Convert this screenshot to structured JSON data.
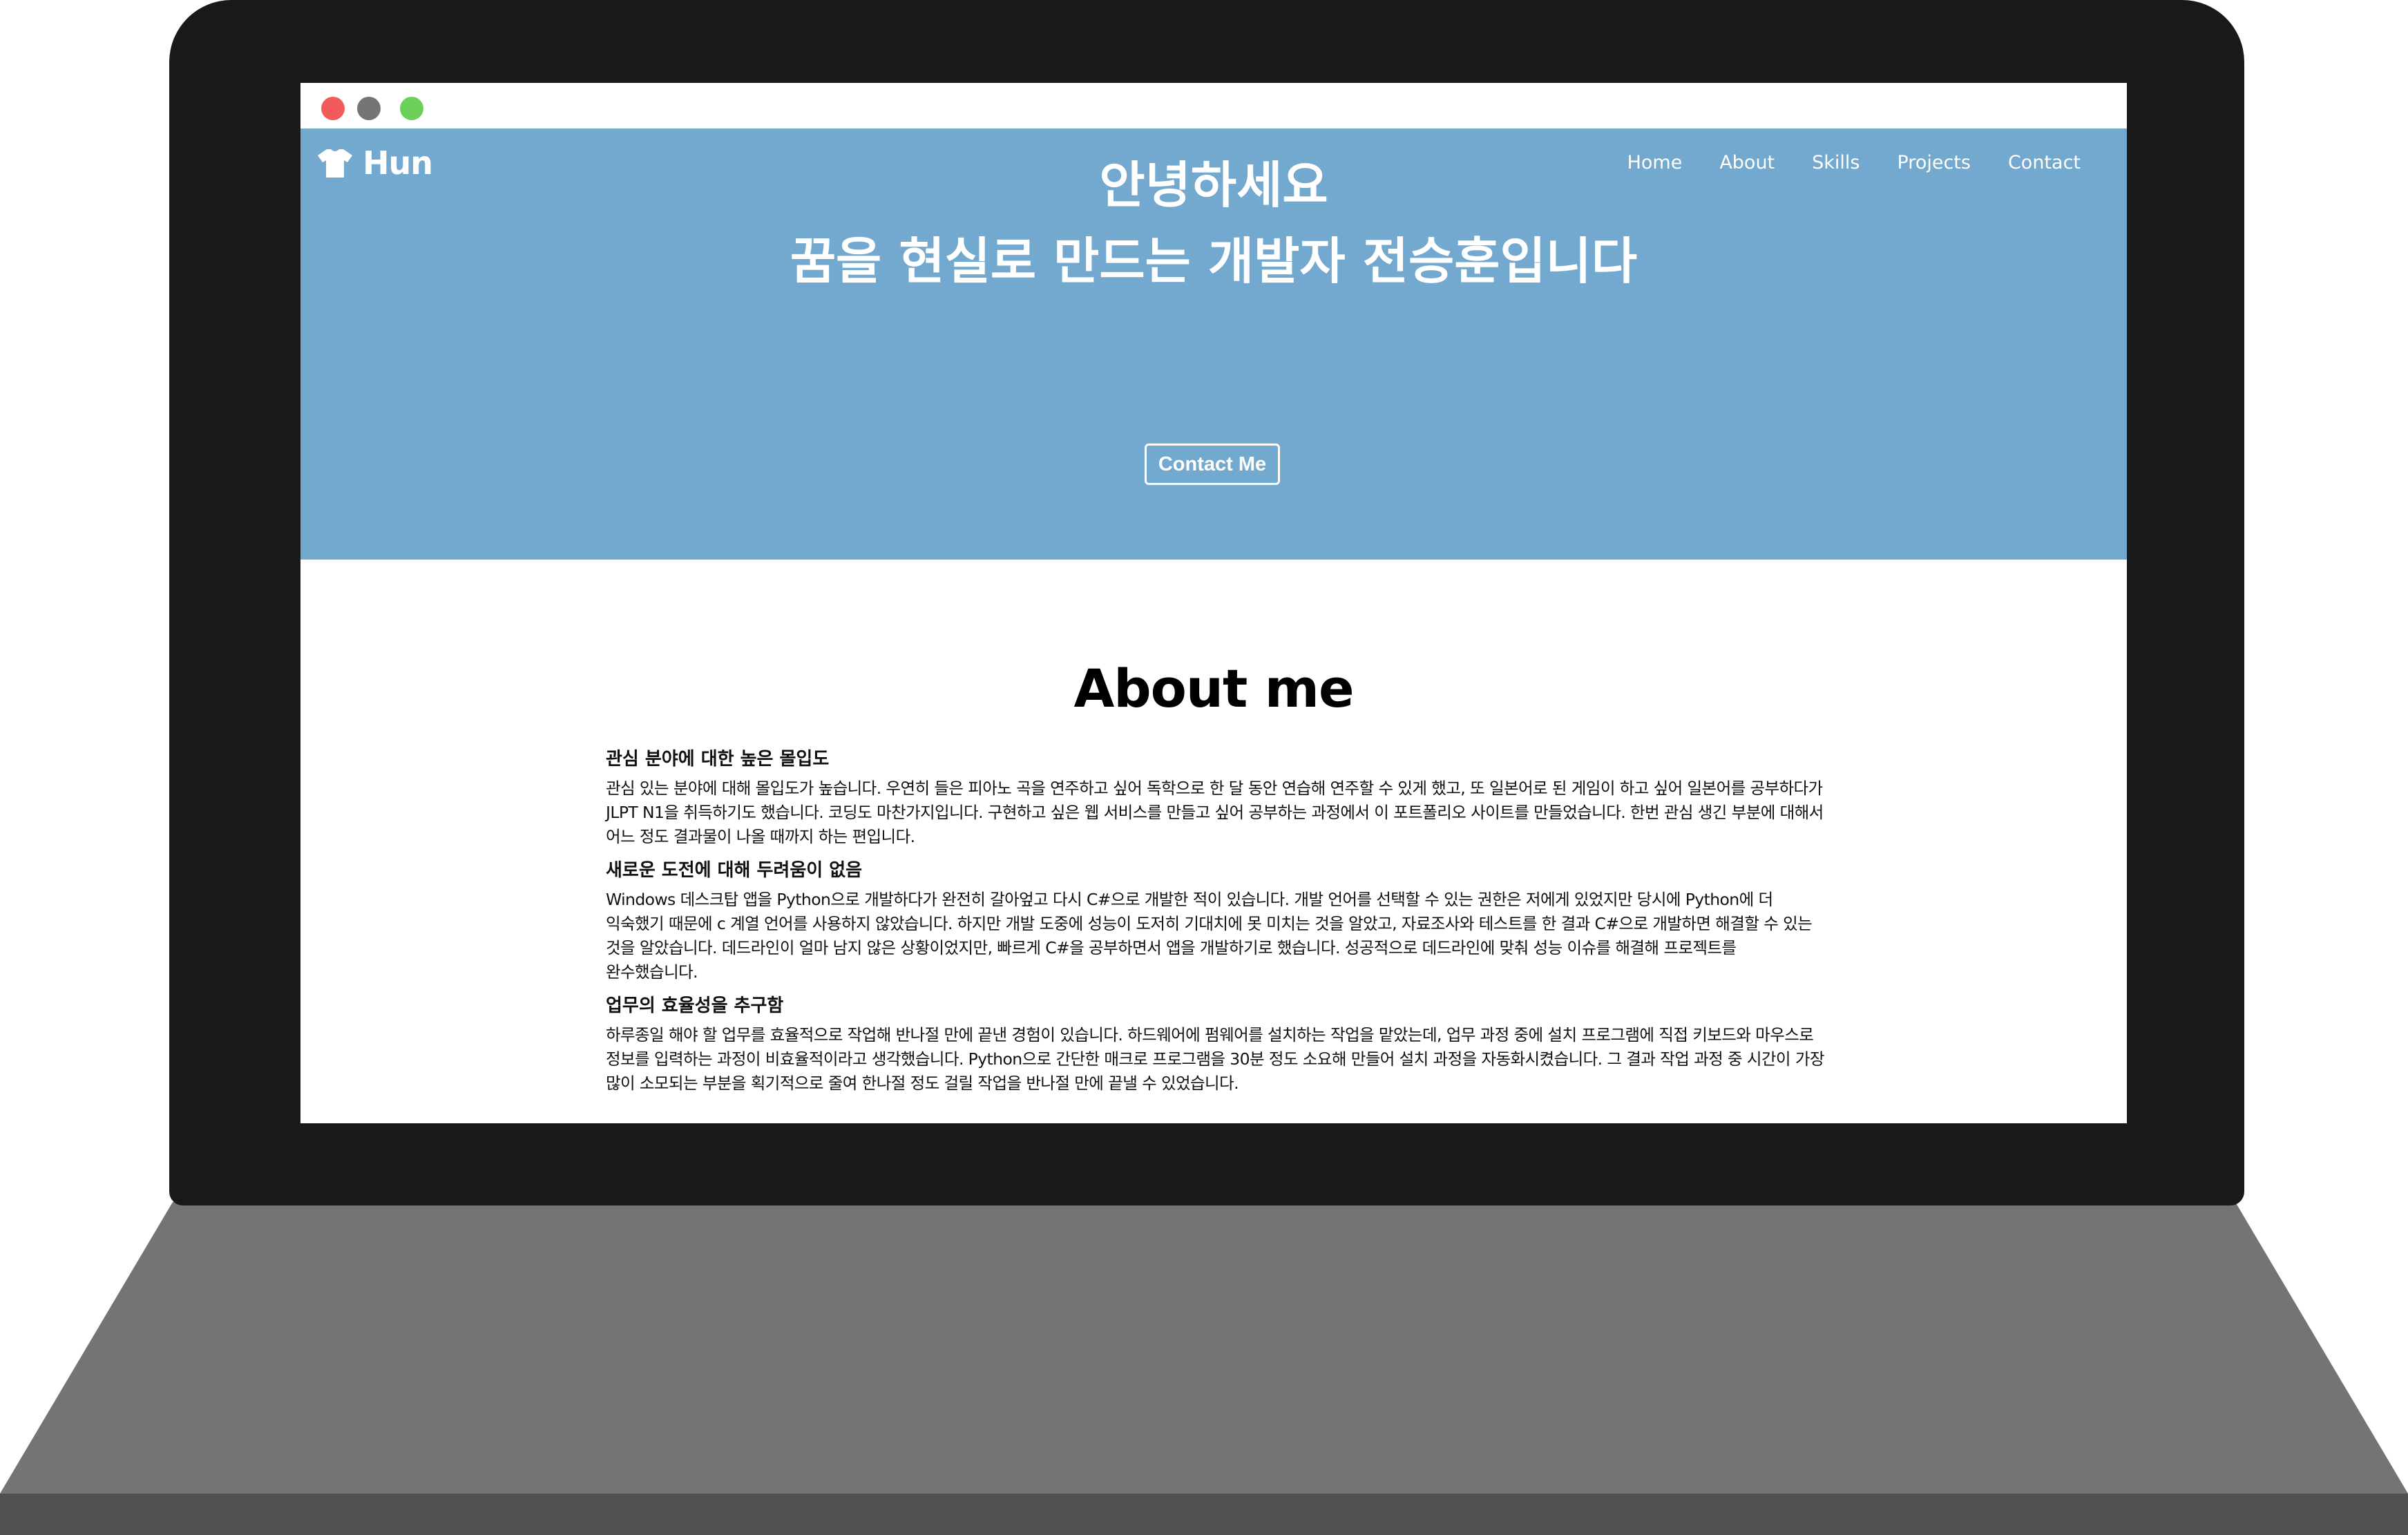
{
  "colors": {
    "hero_bg": "#73a9cf",
    "laptop_bezel": "#191919",
    "laptop_base": "#747474",
    "laptop_base_edge": "#505050",
    "traffic_red": "#f15b5b",
    "traffic_gray": "#757575",
    "traffic_green": "#6ccf58"
  },
  "window": {
    "controls": [
      "close",
      "minimize",
      "maximize"
    ]
  },
  "navbar": {
    "brand_icon": "shirt-icon",
    "brand": "Hun",
    "menu": [
      {
        "label": "Home"
      },
      {
        "label": "About"
      },
      {
        "label": "Skills"
      },
      {
        "label": "Projects"
      },
      {
        "label": "Contact"
      }
    ]
  },
  "hero": {
    "line1": "안녕하세요",
    "line2": "꿈을 현실로 만드는 개발자 전승훈입니다",
    "button": "Contact Me"
  },
  "about": {
    "title": "About me",
    "sections": [
      {
        "heading": "관심 분야에 대한 높은 몰입도",
        "text": "관심 있는 분야에 대해 몰입도가 높습니다. 우연히 들은 피아노 곡을 연주하고 싶어 독학으로 한 달 동안 연습해 연주할 수 있게 했고, 또 일본어로 된 게임이 하고 싶어 일본어를 공부하다가 JLPT N1을 취득하기도 했습니다. 코딩도 마찬가지입니다. 구현하고 싶은 웹 서비스를 만들고 싶어 공부하는 과정에서 이 포트폴리오 사이트를 만들었습니다. 한번 관심 생긴 부분에 대해서 어느 정도 결과물이 나올 때까지 하는 편입니다."
      },
      {
        "heading": "새로운 도전에 대해 두려움이 없음",
        "text": "Windows 데스크탑 앱을 Python으로 개발하다가 완전히 갈아엎고 다시 C#으로 개발한 적이 있습니다. 개발 언어를 선택할 수 있는 권한은 저에게 있었지만 당시에 Python에 더 익숙했기 때문에 c 계열 언어를 사용하지 않았습니다. 하지만 개발 도중에 성능이 도저히 기대치에 못 미치는 것을 알았고, 자료조사와 테스트를 한 결과 C#으로 개발하면 해결할 수 있는 것을 알았습니다. 데드라인이 얼마 남지 않은 상황이었지만, 빠르게 C#을 공부하면서 앱을 개발하기로 했습니다. 성공적으로 데드라인에 맞춰 성능 이슈를 해결해 프로젝트를 완수했습니다."
      },
      {
        "heading": "업무의 효율성을 추구함",
        "text": "하루종일 해야 할 업무를 효율적으로 작업해 반나절 만에 끝낸 경험이 있습니다. 하드웨어에 펌웨어를 설치하는 작업을 맡았는데, 업무 과정 중에 설치 프로그램에 직접 키보드와 마우스로 정보를 입력하는 과정이 비효율적이라고 생각했습니다. Python으로 간단한 매크로 프로그램을 30분 정도 소요해 만들어 설치 과정을 자동화시켰습니다. 그 결과 작업 과정 중 시간이 가장 많이 소모되는 부분을 획기적으로 줄여 한나절 정도 걸릴 작업을 반나절 만에 끝낼 수 있었습니다."
      }
    ]
  }
}
